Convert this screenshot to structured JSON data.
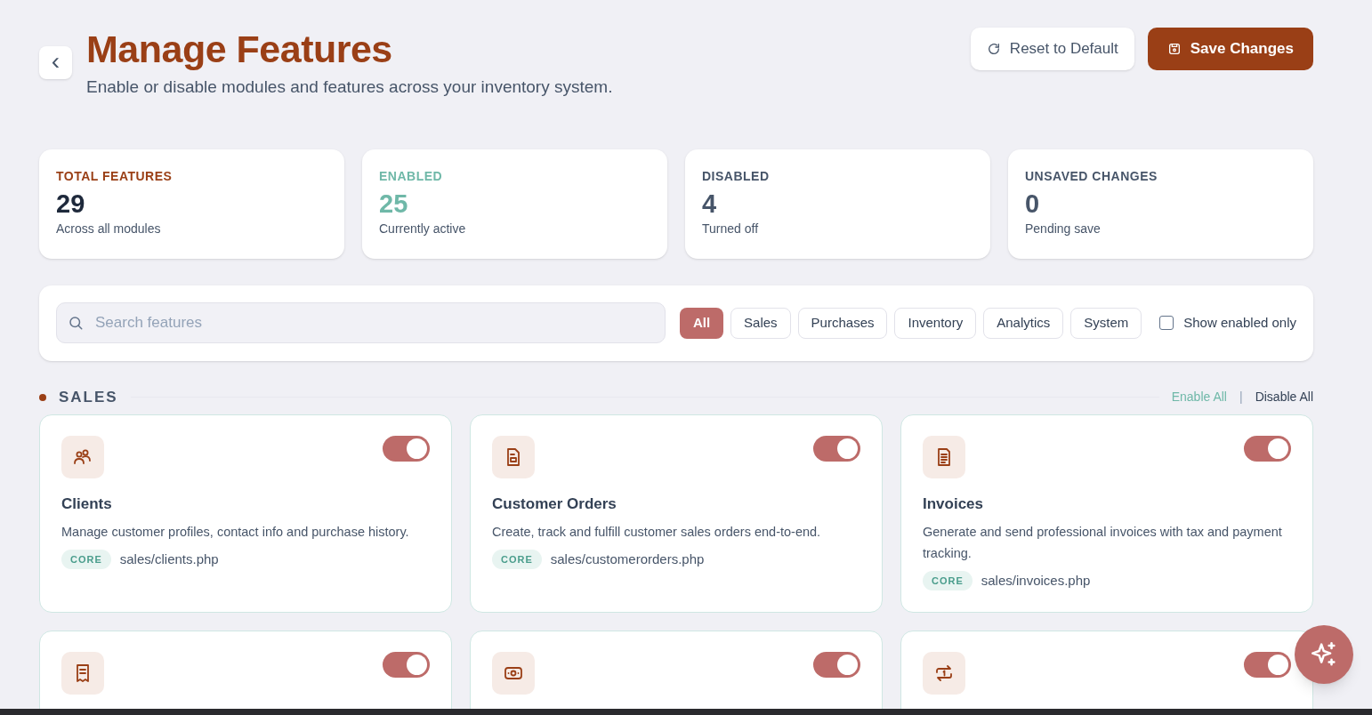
{
  "header": {
    "back": "‹",
    "title": "Manage Features",
    "subtitle": "Enable or disable modules and features across your inventory system.",
    "reset_button": "Reset to Default",
    "save_button": "Save Changes"
  },
  "stats": [
    {
      "kind": "total",
      "label": "TOTAL FEATURES",
      "value": "29",
      "note": "Across all modules"
    },
    {
      "kind": "enabled",
      "label": "ENABLED",
      "value": "25",
      "note": "Currently active"
    },
    {
      "kind": "neutral",
      "label": "DISABLED",
      "value": "4",
      "note": "Turned off"
    },
    {
      "kind": "neutral",
      "label": "UNSAVED CHANGES",
      "value": "0",
      "note": "Pending save"
    }
  ],
  "filters": {
    "search": {
      "placeholder": "Search features"
    },
    "chips": [
      {
        "label": "All",
        "selected": true
      },
      {
        "label": "Sales",
        "selected": false
      },
      {
        "label": "Purchases",
        "selected": false
      },
      {
        "label": "Inventory",
        "selected": false
      },
      {
        "label": "Analytics",
        "selected": false
      },
      {
        "label": "System",
        "selected": false
      }
    ],
    "show_enabled_only": {
      "label": "Show enabled only",
      "checked": false
    }
  },
  "section": {
    "title": "SALES",
    "enable_all": "Enable All",
    "separator": "|",
    "disable_all": "Disable All",
    "cards": [
      {
        "name": "Clients",
        "description": "Manage customer profiles, contact info and purchase history.",
        "badge": "CORE",
        "path": "sales/clients.php",
        "on": true
      },
      {
        "name": "Customer Orders",
        "description": "Create, track and fulfill customer sales orders end-to-end.",
        "badge": "CORE",
        "path": "sales/customerorders.php",
        "on": true
      },
      {
        "name": "Invoices",
        "description": "Generate and send professional invoices with tax and payment tracking.",
        "badge": "CORE",
        "path": "sales/invoices.php",
        "on": true
      },
      {
        "on": true
      },
      {
        "on": true
      },
      {
        "on": true
      }
    ]
  }
}
